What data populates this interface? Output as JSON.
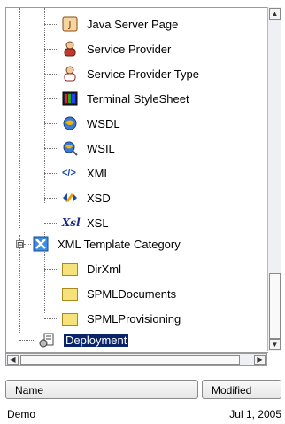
{
  "tree": {
    "items": [
      {
        "label": "Java Server Page",
        "icon": "java-server-page-icon"
      },
      {
        "label": "Service Provider",
        "icon": "service-provider-icon"
      },
      {
        "label": "Service Provider Type",
        "icon": "service-provider-type-icon"
      },
      {
        "label": "Terminal StyleSheet",
        "icon": "terminal-stylesheet-icon"
      },
      {
        "label": "WSDL",
        "icon": "wsdl-icon"
      },
      {
        "label": "WSIL",
        "icon": "wsil-icon"
      },
      {
        "label": "XML",
        "icon": "xml-icon",
        "glyph": "</>"
      },
      {
        "label": "XSD",
        "icon": "xsd-icon"
      },
      {
        "label": "XSL",
        "icon": "xsl-icon",
        "glyph": "Xsl"
      }
    ],
    "category": {
      "label": "XML Template Category",
      "expander": "⊟"
    },
    "children": [
      {
        "label": "DirXml"
      },
      {
        "label": "SPMLDocuments"
      },
      {
        "label": "SPMLProvisioning"
      }
    ],
    "deployment": {
      "label": "Deployment"
    }
  },
  "table": {
    "columns": [
      "Name",
      "Modified"
    ],
    "rows": [
      {
        "name": "Demo",
        "modified": "Jul 1, 2005"
      }
    ]
  },
  "colors": {
    "selection": "#0a246a"
  }
}
